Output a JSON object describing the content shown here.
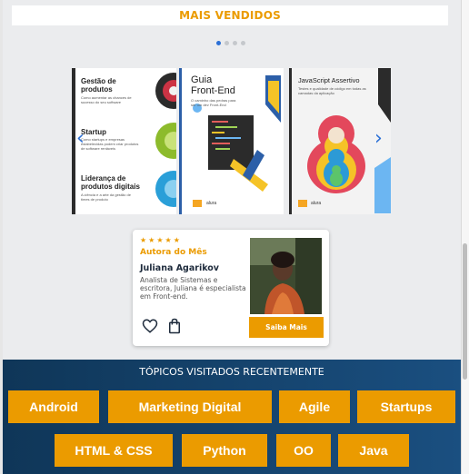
{
  "bestsellers": {
    "title": "MAIS VENDIDOS"
  },
  "carousel": {
    "dots": 4,
    "active_dot": 0,
    "books": [
      {
        "sections": [
          {
            "title": "Gestão de produtos",
            "text": "Como aumentar as chances de sucesso do seu software"
          },
          {
            "title": "Startup",
            "text": "Como startups e empresas estabelecidas podem criar produtos de software rentáveis"
          },
          {
            "title": "Liderança de produtos digitais",
            "text": "A ciência e a arte da gestão de times de produto"
          }
        ]
      },
      {
        "title_line1": "Guia",
        "title_line2": "Front-End",
        "subtitle": "O caminho das pedras para ser um dev Front-End",
        "publisher": "alura"
      },
      {
        "title": "JavaScript Assertivo",
        "subtitle": "Testes e qualidade de código em todas as camadas da aplicação",
        "publisher": "alura"
      }
    ]
  },
  "author_card": {
    "stars": "★★★★★",
    "kicker": "Autora do Mês",
    "name": "Juliana Agarikov",
    "bio": "Analista de Sistemas e escritora, Juliana é especialista em Front-end.",
    "cta": "Saiba Mais"
  },
  "topics": {
    "title": "TÓPICOS VISITADOS RECENTEMENTE",
    "tags": [
      "Android",
      "Marketing Digital",
      "Agile",
      "Startups",
      "HTML & CSS",
      "Python",
      "OO",
      "Java"
    ]
  }
}
